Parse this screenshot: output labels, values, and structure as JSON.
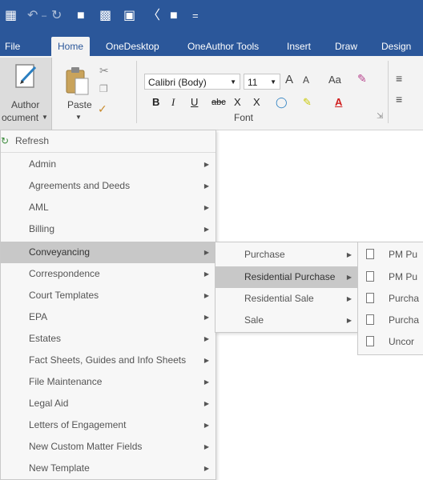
{
  "quick_access": {
    "save_icon": "save-icon",
    "undo_icon": "undo-icon",
    "redo_icon": "redo-icon",
    "folder_icon": "folder-icon",
    "print_icon": "print-icon",
    "preview_icon": "print-preview-icon",
    "email_icon": "email-icon",
    "square_icon": "square-icon",
    "customize": "="
  },
  "tabs": [
    "File",
    "Home",
    "OneDesktop",
    "OneAuthor Tools",
    "Insert",
    "Draw",
    "Design"
  ],
  "ribbon": {
    "author_line1": "Author",
    "author_line2": "ocument",
    "paste_label": "Paste",
    "font_name": "Calibri (Body)",
    "font_size": "11",
    "grow": "A",
    "shrink": "A",
    "change_case": "Aa",
    "bold": "B",
    "italic": "I",
    "underline": "U",
    "strike": "abc",
    "sub": "X",
    "sup": "X",
    "font_group": "Font"
  },
  "menu": {
    "refresh": "Refresh",
    "items": [
      "Admin",
      "Agreements and Deeds",
      "AML",
      "Billing",
      "Conveyancing",
      "Correspondence",
      "Court Templates",
      "EPA",
      "Estates",
      "Fact Sheets, Guides and Info Sheets",
      "File Maintenance",
      "Legal Aid",
      "Letters of Engagement",
      "New Custom Matter Fields",
      "New Template"
    ]
  },
  "submenu1": {
    "items": [
      "Purchase",
      "Residential Purchase",
      "Residential Sale",
      "Sale"
    ]
  },
  "submenu2": {
    "items": [
      "PM Pu",
      "PM Pu",
      "Purcha",
      "Purcha",
      "Uncor"
    ]
  },
  "colors": {
    "word_blue": "#2b579a",
    "ribbon_bg": "#f3f3f3",
    "menu_bg": "#f7f7f7",
    "menu_highlight": "#c8c8c8"
  }
}
